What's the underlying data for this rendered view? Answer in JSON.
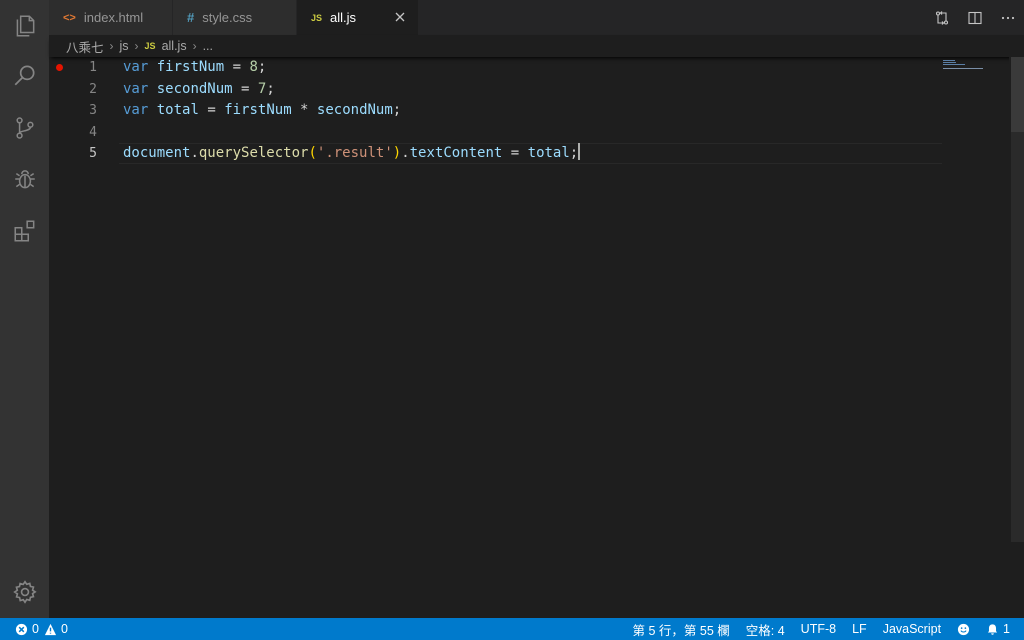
{
  "tabs": [
    {
      "label": "index.html",
      "icon": "html-icon",
      "icon_glyph": "<>"
    },
    {
      "label": "style.css",
      "icon": "css-icon",
      "icon_glyph": "#"
    },
    {
      "label": "all.js",
      "icon": "js-icon",
      "icon_glyph": "JS",
      "active": true
    }
  ],
  "breadcrumb": {
    "folder": "八乘七",
    "subfolder": "js",
    "file_glyph": "JS",
    "file": "all.js",
    "symbol": "..."
  },
  "editor": {
    "line_numbers": [
      "1",
      "2",
      "3",
      "4",
      "5"
    ],
    "current_line": 5,
    "breakpoint_line": 1
  },
  "code": {
    "l1": {
      "kw": "var",
      "name": "firstNum",
      "eq": " = ",
      "val": "8",
      "end": ";"
    },
    "l2": {
      "kw": "var",
      "name": "secondNum",
      "eq": " = ",
      "val": "7",
      "end": ";"
    },
    "l3": {
      "kw": "var",
      "name": "total",
      "eq": " = ",
      "a": "firstNum",
      "op": " * ",
      "b": "secondNum",
      "end": ";"
    },
    "l5": {
      "obj": "document",
      "dot1": ".",
      "fn": "querySelector",
      "open": "(",
      "str": "'.result'",
      "close": ")",
      "dot2": ".",
      "prop": "textContent",
      "eq": " = ",
      "val": "total",
      "end": ";"
    }
  },
  "statusbar": {
    "errors": "0",
    "warnings": "0",
    "position": "第 5 行，第 55 欄",
    "spaces": "空格: 4",
    "encoding": "UTF-8",
    "eol": "LF",
    "language": "JavaScript",
    "notifications": "1"
  },
  "colors": {
    "statusbar": "#007acc",
    "activity_bar": "#333333",
    "editor_bg": "#1e1e1e",
    "breakpoint": "#e51400"
  }
}
